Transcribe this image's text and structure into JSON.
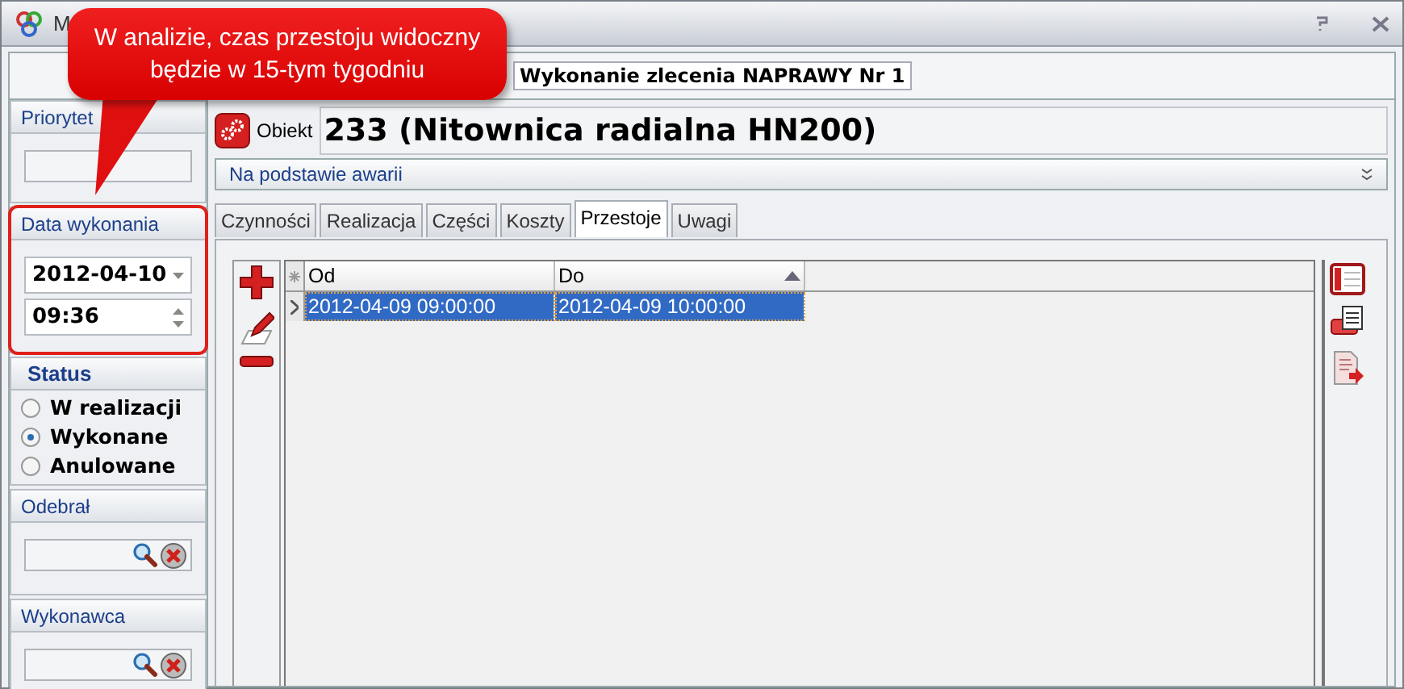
{
  "window": {
    "title": "M"
  },
  "callout": {
    "text": "W analizie, czas przestoju widoczny będzie w 15-tym tygodniu"
  },
  "header": {
    "title": "Wykonanie zlecenia NAPRAWY Nr 1"
  },
  "sidebar": {
    "priorytet": {
      "label": "Priorytet"
    },
    "data_wykonania": {
      "label": "Data wykonania",
      "date": "2012-04-10",
      "time": "09:36",
      "highlighted": true
    },
    "status": {
      "label": "Status",
      "options": [
        {
          "label": "W realizacji",
          "selected": false
        },
        {
          "label": "Wykonane",
          "selected": true
        },
        {
          "label": "Anulowane",
          "selected": false
        }
      ]
    },
    "odebral": {
      "label": "Odebrał"
    },
    "wykonawca": {
      "label": "Wykonawca"
    }
  },
  "object": {
    "button_label": "Obiekt",
    "value": "233 (Nitownica radialna HN200)"
  },
  "basis": {
    "value": "Na podstawie awarii"
  },
  "tabs": [
    {
      "label": "Czynności",
      "selected": false
    },
    {
      "label": "Realizacja",
      "selected": false
    },
    {
      "label": "Części",
      "selected": false
    },
    {
      "label": "Koszty",
      "selected": false
    },
    {
      "label": "Przestoje",
      "selected": true
    },
    {
      "label": "Uwagi",
      "selected": false
    }
  ],
  "grid": {
    "columns": [
      {
        "label": "Od",
        "sorted": false
      },
      {
        "label": "Do",
        "sorted": true
      }
    ],
    "rows": [
      {
        "cells": [
          "2012-04-09 09:00:00",
          "2012-04-09 10:00:00"
        ],
        "selected": true
      }
    ]
  }
}
